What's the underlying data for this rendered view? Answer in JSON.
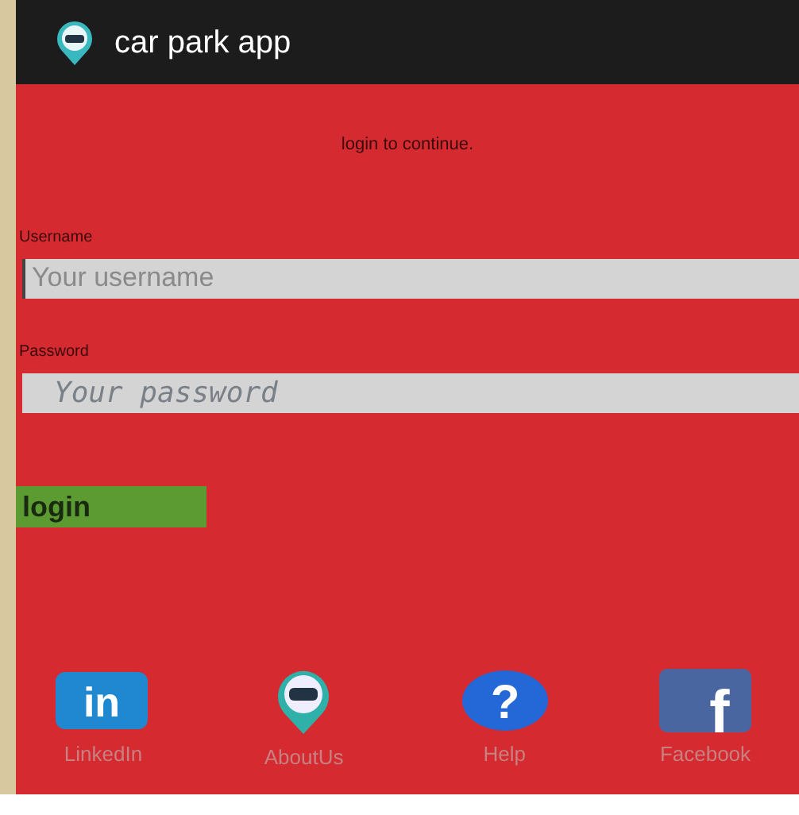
{
  "app_bar": {
    "title": "car park app"
  },
  "prompt": "login to continue.",
  "fields": [
    {
      "label": "Username",
      "placeholder": "Your username",
      "kind": "text"
    },
    {
      "label": "Password",
      "placeholder": "Your password",
      "kind": "password"
    }
  ],
  "login_button": "login",
  "footer_links": [
    {
      "label": "LinkedIn",
      "kind": "linkedin",
      "glyph": "in"
    },
    {
      "label": "AboutUs",
      "kind": "pin"
    },
    {
      "label": "Help",
      "kind": "help",
      "glyph": "?"
    },
    {
      "label": "Facebook",
      "kind": "facebook",
      "glyph": "f"
    }
  ]
}
